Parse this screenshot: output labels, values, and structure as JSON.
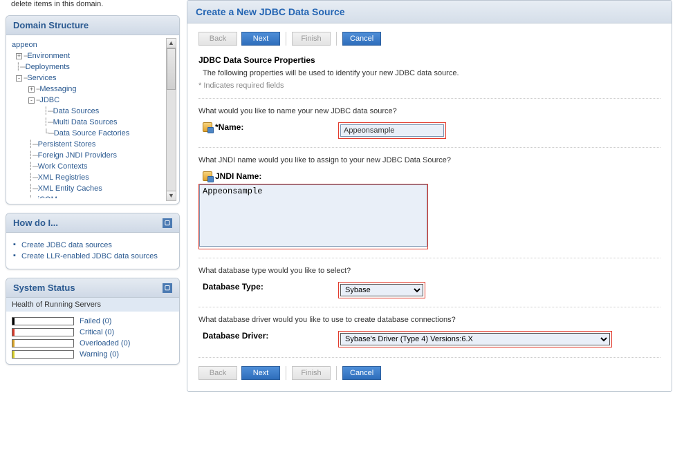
{
  "topNote": "delete items in this domain.",
  "domainStructure": {
    "title": "Domain Structure",
    "root": "appeon",
    "items": {
      "environment": "Environment",
      "deployments": "Deployments",
      "services": "Services",
      "messaging": "Messaging",
      "jdbc": "JDBC",
      "dataSources": "Data Sources",
      "multiDataSources": "Multi Data Sources",
      "dataSourceFactories": "Data Source Factories",
      "persistentStores": "Persistent Stores",
      "foreignJndi": "Foreign JNDI Providers",
      "workContexts": "Work Contexts",
      "xmlRegistries": "XML Registries",
      "xmlEntityCaches": "XML Entity Caches",
      "jcom": "jCOM"
    }
  },
  "howDoI": {
    "title": "How do I...",
    "links": [
      "Create JDBC data sources",
      "Create LLR-enabled JDBC data sources"
    ]
  },
  "systemStatus": {
    "title": "System Status",
    "subtitle": "Health of Running Servers",
    "rows": [
      {
        "label": "Failed (0)",
        "color": "#000000"
      },
      {
        "label": "Critical (0)",
        "color": "#d83a2b"
      },
      {
        "label": "Overloaded (0)",
        "color": "#d8a52b"
      },
      {
        "label": "Warning (0)",
        "color": "#d8d12b"
      }
    ]
  },
  "main": {
    "title": "Create a New JDBC Data Source",
    "buttons": {
      "back": "Back",
      "next": "Next",
      "finish": "Finish",
      "cancel": "Cancel"
    },
    "propsTitle": "JDBC Data Source Properties",
    "propsDesc": "The following properties will be used to identify your new JDBC data source.",
    "requiredNote": "* Indicates required fields",
    "fields": {
      "nameQ": "What would you like to name your new JDBC data source?",
      "nameLabel": "Name:",
      "nameValue": "Appeonsample",
      "jndiQ": "What JNDI name would you like to assign to your new JDBC Data Source?",
      "jndiLabel": "JNDI Name:",
      "jndiValue": "Appeonsample",
      "dbTypeQ": "What database type would you like to select?",
      "dbTypeLabel": "Database Type:",
      "dbTypeValue": "Sybase",
      "dbDriverQ": "What database driver would you like to use to create database connections?",
      "dbDriverLabel": "Database Driver:",
      "dbDriverValue": "Sybase's Driver (Type 4) Versions:6.X"
    }
  }
}
